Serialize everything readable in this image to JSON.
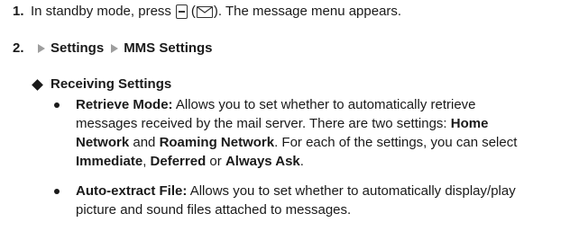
{
  "step1": {
    "number": "1.",
    "text_before": "In standby mode, press",
    "paren_open": "(",
    "text_after": "). The message menu appears."
  },
  "step2": {
    "number": "2.",
    "menu_1": "Settings",
    "menu_2": "MMS Settings"
  },
  "section": {
    "title": "Receiving Settings"
  },
  "bullets": [
    {
      "term": "Retrieve Mode:",
      "line1": "Allows you to set whether to automatically retrieve",
      "line2_a": "messages received by the mail server. There are two settings:",
      "line2_b": "Home",
      "line3_a": "Network",
      "line3_b": "and",
      "line3_c": "Roaming Network",
      "line3_d": ". For each of the settings, you can select",
      "line4_a": "Immediate",
      "line4_b": ",",
      "line4_c": "Deferred",
      "line4_d": "or",
      "line4_e": "Always Ask",
      "line4_f": "."
    },
    {
      "term": "Auto-extract File:",
      "line1": "Allows you to set whether to automatically display/play",
      "line2": "picture and sound files attached to messages."
    }
  ],
  "icons": {
    "soft_key": "minus-key-icon",
    "message": "envelope-icon",
    "arrow": "triangle-right-icon",
    "section": "diamond-bullet-icon"
  },
  "colors": {
    "arrow": "#9e9e9e",
    "text": "#1a1a1a"
  }
}
